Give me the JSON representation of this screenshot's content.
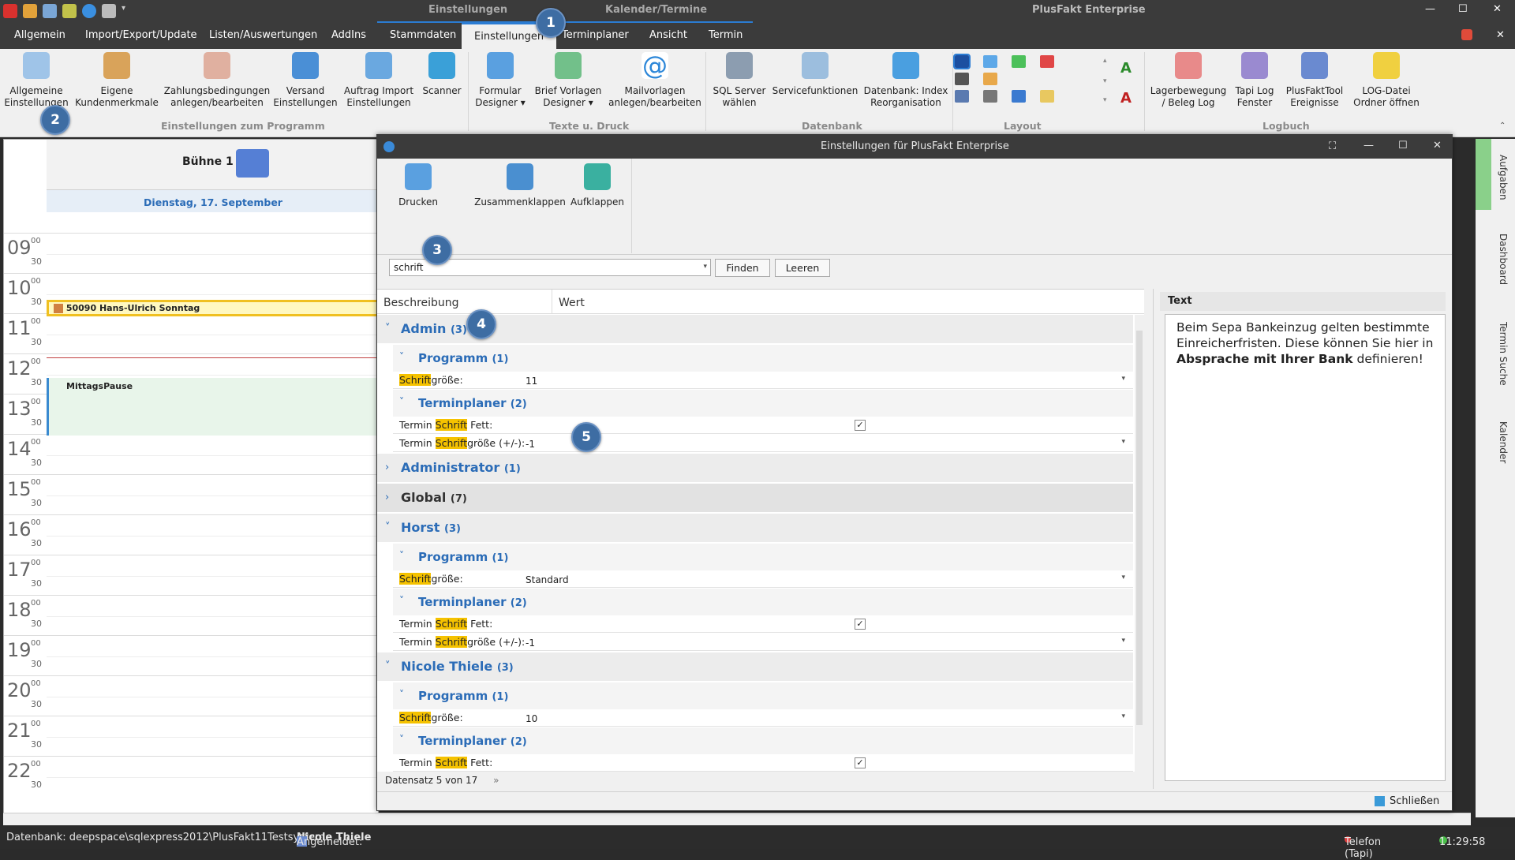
{
  "titlebar": {
    "contexts": [
      "Einstellungen",
      "Kalender/Termine"
    ],
    "app_title": "PlusFakt Enterprise"
  },
  "menu": [
    "Allgemein",
    "Import/Export/Update",
    "Listen/Auswertungen",
    "AddIns",
    "Stammdaten",
    "Einstellungen",
    "Terminplaner",
    "Ansicht",
    "Termin"
  ],
  "ribbon": {
    "buttons": [
      {
        "label": "Allgemeine\nEinstellungen"
      },
      {
        "label": "Eigene\nKundenmerkmale"
      },
      {
        "label": "Zahlungsbedingungen\nanlegen/bearbeiten"
      },
      {
        "label": "Versand\nEinstellungen"
      },
      {
        "label": "Auftrag Import\nEinstellungen"
      },
      {
        "label": "Scanner"
      },
      {
        "label": "Formular\nDesigner ▾"
      },
      {
        "label": "Brief Vorlagen\nDesigner ▾"
      },
      {
        "label": "Mailvorlagen\nanlegen/bearbeiten"
      },
      {
        "label": "SQL Server\nwählen"
      },
      {
        "label": "Servicefunktionen"
      },
      {
        "label": "Datenbank: Index\nReorganisation"
      },
      {
        "label": "Lagerbewegung\n/ Beleg Log"
      },
      {
        "label": "Tapi Log\nFenster"
      },
      {
        "label": "PlusFaktTool\nEreignisse"
      },
      {
        "label": "LOG-Datei\nOrdner öffnen"
      }
    ],
    "groups": [
      "Einstellungen zum Programm",
      "Texte u. Druck",
      "Datenbank",
      "Layout",
      "Logbuch"
    ]
  },
  "badges": [
    "1",
    "2",
    "3",
    "4",
    "5"
  ],
  "calendar": {
    "resource": "Bühne 1",
    "date": "Dienstag, 17. September",
    "hours": [
      "09",
      "10",
      "11",
      "12",
      "13",
      "14",
      "15",
      "16",
      "17",
      "18",
      "19",
      "20",
      "21",
      "22"
    ],
    "minute_labels": {
      "full": "00",
      "half": "30"
    },
    "appointments": [
      {
        "label": "50090 Hans-Ulrich Sonntag"
      },
      {
        "label": "MittagsPause"
      }
    ]
  },
  "sidebar_tabs": [
    "Aufgaben",
    "Dashboard",
    "Termin Suche",
    "Kalender"
  ],
  "dialog": {
    "title": "Einstellungen für PlusFakt Enterprise",
    "toolbar": [
      "Drucken",
      "Zusammenklappen",
      "Aufklappen"
    ],
    "search_value": "schrift",
    "find_label": "Finden",
    "clear_label": "Leeren",
    "col_desc": "Beschreibung",
    "col_value": "Wert",
    "text_header": "Text",
    "text_body_1": "Beim Sepa Bankeinzug gelten bestimmte Einreicherfristen. Diese können Sie hier in ",
    "text_body_bold": "Absprache mit Ihrer Bank",
    "text_body_2": " definieren!",
    "footer": "Datensatz 5 von 17",
    "close_label": "Schließen"
  },
  "tree": {
    "admin": {
      "name": "Admin",
      "count": "(3)"
    },
    "programm": {
      "name": "Programm",
      "count": "(1)"
    },
    "terminplaner": {
      "name": "Terminplaner",
      "count": "(2)"
    },
    "administrator": {
      "name": "Administrator",
      "count": "(1)"
    },
    "global": {
      "name": "Global",
      "count": "(7)"
    },
    "horst": {
      "name": "Horst",
      "count": "(3)"
    },
    "nicole": {
      "name": "Nicole Thiele",
      "count": "(3)"
    },
    "prop_pre_schrift": "Termin ",
    "schrift": "Schrift",
    "groesse": "größe:",
    "fett": " Fett:",
    "groesse_pm": "größe (+/-):",
    "values": {
      "admin_size": "11",
      "admin_delta": "-1",
      "horst_size": "Standard",
      "horst_delta": "-1",
      "nicole_size": "10"
    }
  },
  "status": {
    "db": "Datenbank: deepspace\\sqlexpress2012\\PlusFakt11Testsystem",
    "user_label": "Angemeldet:",
    "user": "Nicole Thiele",
    "phone": "Telefon (Tapi)",
    "time": "11:29:58"
  }
}
